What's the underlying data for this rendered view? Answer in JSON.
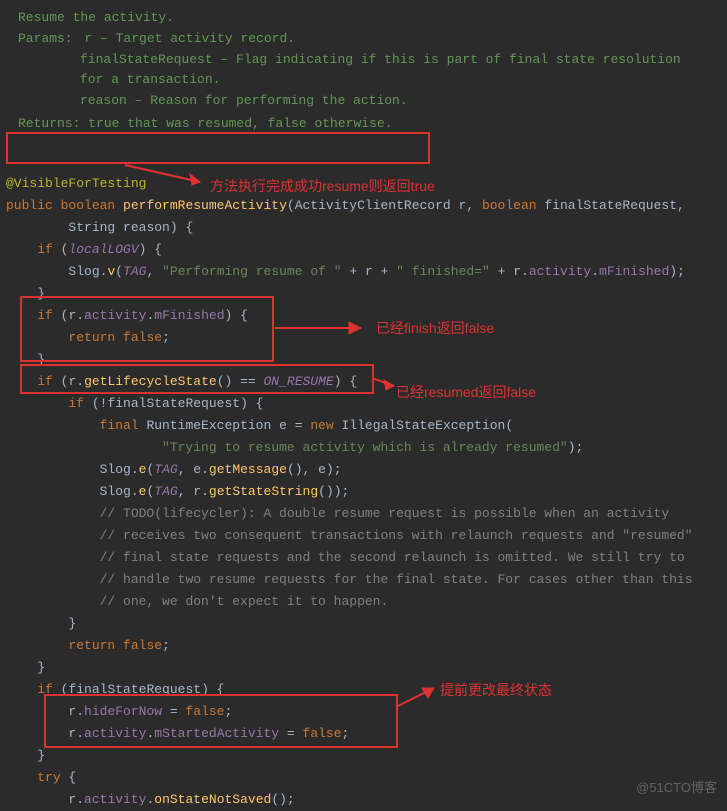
{
  "doc": {
    "summary": "Resume the activity.",
    "params_label": "Params:",
    "param1": "r – Target activity record.",
    "param2_a": "finalStateRequest – Flag indicating if this is part of final state resolution",
    "param2_b": "for a transaction.",
    "param3": "reason – Reason for performing the action.",
    "returns_full": "Returns: true that was resumed, false otherwise."
  },
  "annotations": {
    "a1": "方法执行完成成功resume则返回true",
    "a2": "已经finish返回false",
    "a3": "已经resumed返回false",
    "a4": "提前更改最终状态"
  },
  "code": {
    "annotation": "@VisibleForTesting",
    "sig_public": "public",
    "sig_boolean": "boolean",
    "sig_name": "performResumeActivity",
    "sig_p1_type": "ActivityClientRecord",
    "sig_p1_name": "r",
    "sig_p2_type": "boolean",
    "sig_p2_name": "finalStateRequest",
    "sig_p3_type": "String",
    "sig_p3_name": "reason",
    "if1": "if",
    "localLOGV": "localLOGV",
    "slog": "Slog",
    "v": "v",
    "TAG": "TAG",
    "str1": "\"Performing resume of \"",
    "plus": " + ",
    "r": "r",
    "str2": "\" finished=\"",
    "activity": "activity",
    "mFinished": "mFinished",
    "return_false": "return false;",
    "getLifecycleState": "getLifecycleState",
    "ON_RESUME": "ON_RESUME",
    "finalStateRequest": "finalStateRequest",
    "final": "final",
    "RuntimeException": "RuntimeException",
    "e": "e",
    "new": "new",
    "IllegalStateException": "IllegalStateException",
    "str3": "\"Trying to resume activity which is already resumed\"",
    "slog_e": "e",
    "getMessage": "getMessage",
    "getStateString": "getStateString",
    "cmt1": "// TODO(lifecycler): A double resume request is possible when an activity",
    "cmt2": "// receives two consequent transactions with relaunch requests and \"resumed\"",
    "cmt3": "// final state requests and the second relaunch is omitted. We still try to",
    "cmt4": "// handle two resume requests for the final state. For cases other than this",
    "cmt5": "// one, we don't expect it to happen.",
    "hideForNow": "hideForNow",
    "false": "false",
    "mStartedActivity": "mStartedActivity",
    "try": "try",
    "onStateNotSaved": "onStateNotSaved"
  },
  "watermark": "@51CTO博客"
}
